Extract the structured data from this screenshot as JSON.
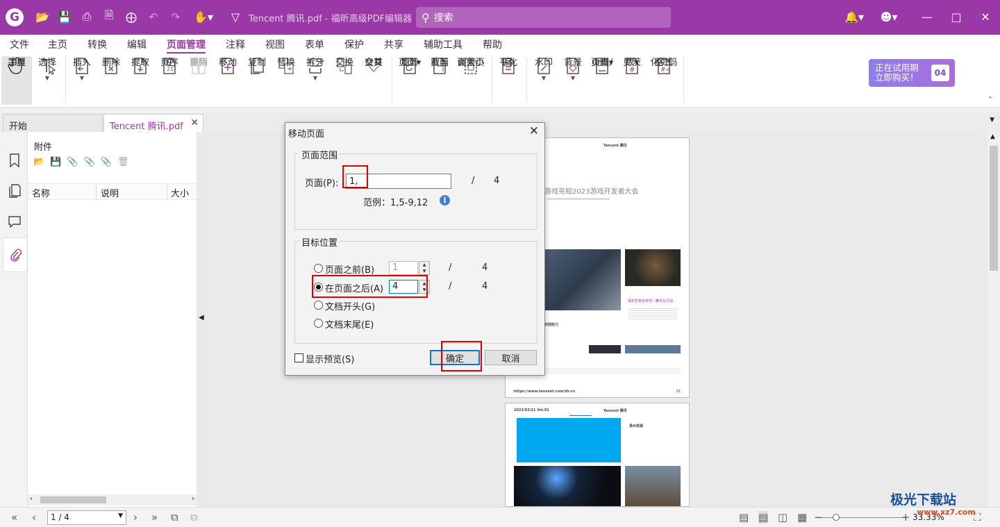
{
  "window": {
    "doc_title": "Tencent 腾讯.pdf - 福昕高级PDF编辑器",
    "search_placeholder": "搜索"
  },
  "menu": [
    "文件",
    "主页",
    "转换",
    "编辑",
    "页面管理",
    "注释",
    "视图",
    "表单",
    "保护",
    "共享",
    "辅助工具",
    "帮助"
  ],
  "active_menu": "页面管理",
  "ribbon": [
    {
      "l1": "手型",
      "l2": "工具"
    },
    {
      "l1": "选择",
      "l2": ""
    },
    {
      "l1": "插入",
      "l2": ""
    },
    {
      "l1": "删除",
      "l2": ""
    },
    {
      "l1": "提取",
      "l2": ""
    },
    {
      "l1": "逆",
      "l2": "页序"
    },
    {
      "l1": "重新",
      "l2": "排列"
    },
    {
      "l1": "移动",
      "l2": ""
    },
    {
      "l1": "复制",
      "l2": ""
    },
    {
      "l1": "替换",
      "l2": ""
    },
    {
      "l1": "拆分",
      "l2": ""
    },
    {
      "l1": "交换",
      "l2": ""
    },
    {
      "l1": "交叉",
      "l2": "合并"
    },
    {
      "l1": "旋转",
      "l2": "页面"
    },
    {
      "l1": "裁剪",
      "l2": "页面"
    },
    {
      "l1": "调整页",
      "l2": "面大小"
    },
    {
      "l1": "扁",
      "l2": "平化"
    },
    {
      "l1": "水印",
      "l2": ""
    },
    {
      "l1": "背景",
      "l2": ""
    },
    {
      "l1": "页眉/",
      "l2": "页脚"
    },
    {
      "l1": "贝茨",
      "l2": "数"
    },
    {
      "l1": "格式",
      "l2": "化页码"
    }
  ],
  "trial": {
    "line1": "正在试用期",
    "line2": "立即购买！",
    "days": "04"
  },
  "tabs": {
    "start": "开始",
    "doc": "Tencent 腾讯.pdf"
  },
  "attachments": {
    "title": "附件",
    "col_name": "名称",
    "col_desc": "说明",
    "col_size": "大小"
  },
  "dialog": {
    "title": "移动页面",
    "range_group": "页面范围",
    "page_label": "页面(P):",
    "page_value": "1,",
    "slash": "/",
    "total": "4",
    "example": "范例：1,5-9,12",
    "dest_group": "目标位置",
    "before_label": "页面之前(B)",
    "before_value": "1",
    "after_label": "在页面之后(A)",
    "after_value": "4",
    "start_label": "文档开头(G)",
    "end_label": "文档末尾(E)",
    "preview_label": "显示预览(S)",
    "ok": "确定",
    "cancel": "取消"
  },
  "status": {
    "page": "1 / 4",
    "zoom": "33.33%"
  },
  "preview": {
    "p1_header": "Tencent 腾讯",
    "p1_heading": "游戏亮相2023游戏开发者大会",
    "p1_caption": "保护生物多样性！腾讯在行动",
    "p1_sub": "科技助力",
    "p1_url": "https://www.tencent.com/zh-cn",
    "p1_num": "01",
    "p2_date": "2023/03/21 Vol.01",
    "p2_header": "Tencent 腾讯",
    "p2_side": "贵州发展"
  },
  "watermark": {
    "text": "极光下载站",
    "url": "www.xz7.com"
  }
}
